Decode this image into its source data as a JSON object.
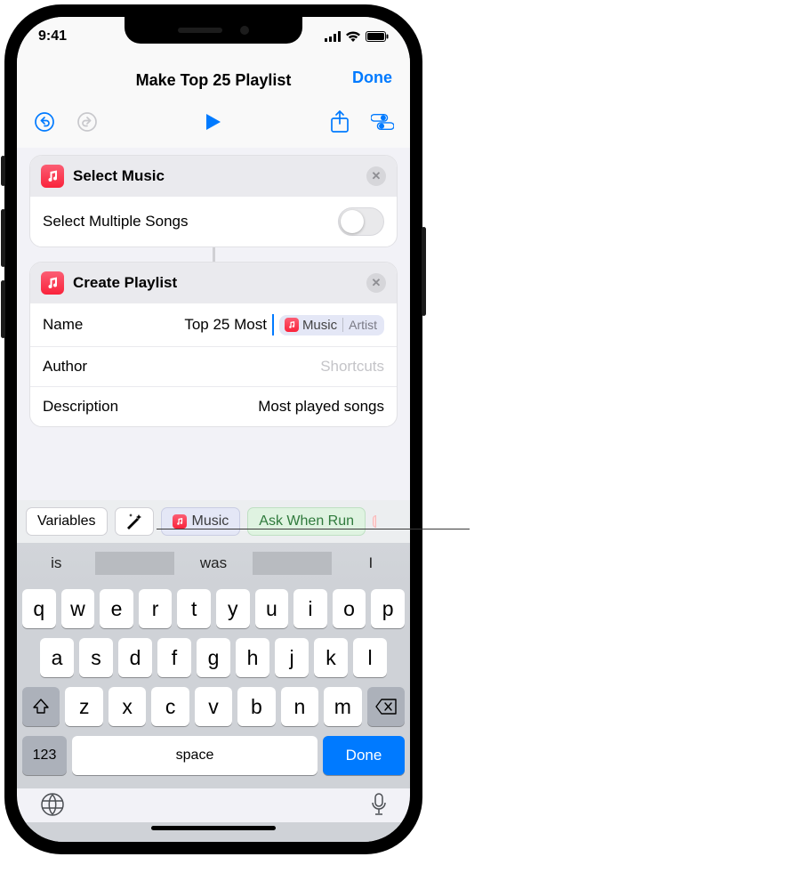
{
  "status": {
    "time": "9:41"
  },
  "header": {
    "title": "Make Top 25 Playlist",
    "done": "Done"
  },
  "action1": {
    "title": "Select Music",
    "row1_label": "Select Multiple Songs"
  },
  "action2": {
    "title": "Create Playlist",
    "name_label": "Name",
    "name_value": "Top 25 Most",
    "token_main": "Music",
    "token_sub": "Artist",
    "author_label": "Author",
    "author_placeholder": "Shortcuts",
    "desc_label": "Description",
    "desc_value": "Most played songs"
  },
  "varbar": {
    "variables": "Variables",
    "music": "Music",
    "ask": "Ask When Run"
  },
  "sugg": {
    "a": "is",
    "b": "was",
    "c": "I"
  },
  "kbd": {
    "row1": [
      "q",
      "w",
      "e",
      "r",
      "t",
      "y",
      "u",
      "i",
      "o",
      "p"
    ],
    "row2": [
      "a",
      "s",
      "d",
      "f",
      "g",
      "h",
      "j",
      "k",
      "l"
    ],
    "row3": [
      "z",
      "x",
      "c",
      "v",
      "b",
      "n",
      "m"
    ],
    "numkey": "123",
    "space": "space",
    "done": "Done"
  }
}
